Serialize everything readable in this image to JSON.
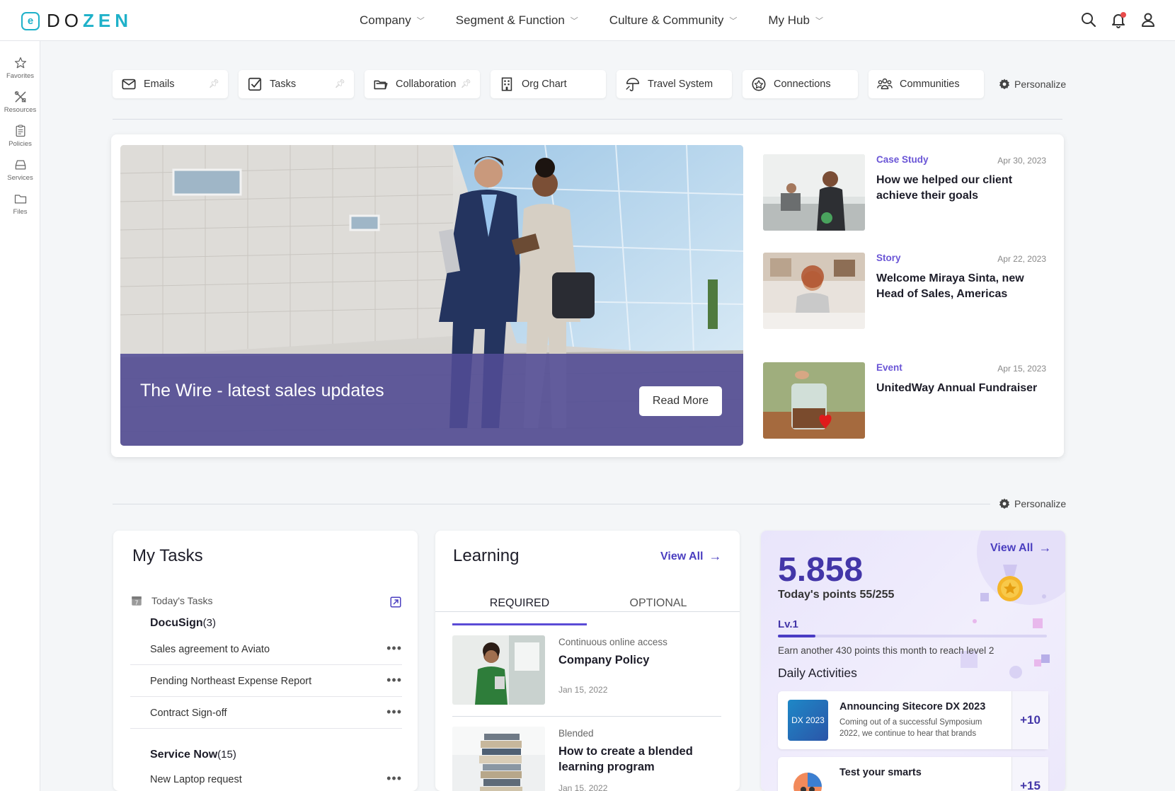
{
  "brand": {
    "logo_text_a": "DO",
    "logo_text_b": "ZEN",
    "logo_glyph": "e",
    "accent": "#1fb1c9"
  },
  "nav": {
    "items": [
      {
        "label": "Company"
      },
      {
        "label": "Segment & Function"
      },
      {
        "label": "Culture & Community"
      },
      {
        "label": "My Hub"
      }
    ],
    "icons": [
      "search-icon",
      "bell-icon",
      "user-icon"
    ]
  },
  "sidebar": {
    "items": [
      {
        "label": "Favorites",
        "icon": "star-icon"
      },
      {
        "label": "Resources",
        "icon": "tools-icon"
      },
      {
        "label": "Policies",
        "icon": "clipboard-icon"
      },
      {
        "label": "Services",
        "icon": "tray-icon"
      },
      {
        "label": "Files",
        "icon": "folder-icon"
      }
    ]
  },
  "quick_links": {
    "items": [
      {
        "label": "Emails",
        "icon": "mail-icon",
        "pinned": true
      },
      {
        "label": "Tasks",
        "icon": "checkbox-icon",
        "pinned": true
      },
      {
        "label": "Collaboration",
        "icon": "folders-icon",
        "pinned": true
      },
      {
        "label": "Org Chart",
        "icon": "building-icon",
        "pinned": false
      },
      {
        "label": "Travel System",
        "icon": "umbrella-icon",
        "pinned": false
      },
      {
        "label": "Connections",
        "icon": "network-icon",
        "pinned": false
      },
      {
        "label": "Communities",
        "icon": "people-icon",
        "pinned": false
      }
    ],
    "personalize_label": "Personalize"
  },
  "hero": {
    "title": "The Wire - latest sales updates",
    "cta": "Read More"
  },
  "news": [
    {
      "category": "Case Study",
      "date": "Apr 30, 2023",
      "title": "How we helped our client achieve their goals"
    },
    {
      "category": "Story",
      "date": "Apr 22, 2023",
      "title": "Welcome Miraya Sinta, new Head of Sales, Americas"
    },
    {
      "category": "Event",
      "date": "Apr 15, 2023",
      "title": "UnitedWay Annual Fundraiser"
    }
  ],
  "section2": {
    "personalize_label": "Personalize"
  },
  "my_tasks": {
    "title": "My Tasks",
    "subheader": "Today's Tasks",
    "groups": [
      {
        "name": "DocuSign",
        "count": "(3)",
        "items": [
          "Sales agreement to Aviato",
          "Pending Northeast Expense Report",
          "Contract Sign-off"
        ]
      },
      {
        "name": "Service Now",
        "count": "(15)",
        "items": [
          "New Laptop request"
        ]
      }
    ],
    "more_glyph": "•••"
  },
  "learning": {
    "title": "Learning",
    "view_all": "View All",
    "tabs": [
      {
        "label": "REQUIRED",
        "active": true
      },
      {
        "label": "OPTIONAL",
        "active": false
      }
    ],
    "items": [
      {
        "type": "Continuous online access",
        "title": "Company Policy",
        "date": "Jan 15, 2022"
      },
      {
        "type": "Blended",
        "title": "How to create a blended learning program",
        "date": "Jan 15, 2022"
      }
    ]
  },
  "points": {
    "view_all": "View All",
    "total": "5.858",
    "today": "Today's points 55/255",
    "level": "Lv.1",
    "level_progress": 0.14,
    "level_text": "Earn another 430 points this month to reach level 2",
    "daily_title": "Daily Activities",
    "activities": [
      {
        "title": "Announcing Sitecore DX 2023",
        "desc": "Coming out of a successful Symposium 2022, we continue to hear that brands",
        "points": "+10",
        "thumb_text": "DX 2023"
      },
      {
        "title": "Test your smarts",
        "desc": "",
        "points": "+15",
        "thumb_text": ""
      }
    ]
  }
}
